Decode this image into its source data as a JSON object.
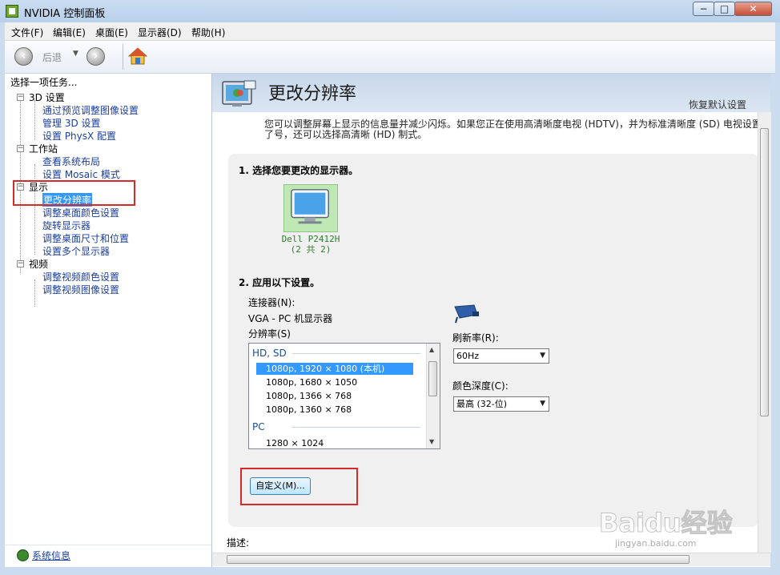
{
  "window": {
    "title": "NVIDIA 控制面板",
    "min_label": "−",
    "max_label": "□",
    "close_label": "✕"
  },
  "menu": {
    "items": [
      "文件(F)",
      "编辑(E)",
      "桌面(E)",
      "显示器(D)",
      "帮助(H)"
    ]
  },
  "toolbar": {
    "back_label": "后退",
    "back_icon": "‹",
    "forward_icon": "›",
    "dropdown_icon": "▼"
  },
  "left_pane": {
    "prompt": "选择一项任务...",
    "categories": [
      {
        "label": "3D 设置",
        "items": [
          "通过预览调整图像设置",
          "管理 3D 设置",
          "设置 PhysX 配置"
        ]
      },
      {
        "label": "工作站",
        "items": [
          "查看系统布局",
          "设置 Mosaic 模式"
        ]
      },
      {
        "label": "显示",
        "items": [
          "更改分辨率",
          "调整桌面颜色设置",
          "旋转显示器",
          "调整桌面尺寸和位置",
          "设置多个显示器"
        ]
      },
      {
        "label": "视频",
        "items": [
          "调整视频颜色设置",
          "调整视频图像设置"
        ]
      }
    ],
    "expander_symbol": "−",
    "system_info": "系统信息"
  },
  "page": {
    "title": "更改分辨率",
    "restore_defaults": "恢复默认设置",
    "description": "您可以调整屏幕上显示的信息量并减少闪烁。如果您正在使用高清晰度电视 (HDTV)，并为标准清晰度 (SD) 电视设置了号，还可以选择高清晰 (HD) 制式。",
    "step1": "1. 选择您要更改的显示器。",
    "monitor": {
      "name": "Dell P2412H",
      "index": "(2 共 2)"
    },
    "step2": "2. 应用以下设置。",
    "connector_label": "连接器(N):",
    "connector_value": "VGA - PC 机显示器",
    "resolution_label": "分辨率(S)",
    "resolution_groups": [
      {
        "header": "HD, SD",
        "rows": [
          "1080p, 1920 × 1080 (本机)",
          "1080p, 1680 × 1050",
          "1080p, 1366 × 768",
          "1080p, 1360 × 768"
        ]
      },
      {
        "header": "PC",
        "rows": [
          "1280 × 1024"
        ]
      }
    ],
    "selected_resolution": "1080p, 1920 × 1080 (本机)",
    "refresh_label": "刷新率(R):",
    "refresh_value": "60Hz",
    "color_depth_label": "颜色深度(C):",
    "color_depth_value": "最高 (32-位)",
    "custom_button": "自定义(M)...",
    "desc_label": "描述:"
  },
  "scrollbar": {
    "up": "▲",
    "down": "▼",
    "left": "◀",
    "right": "▶"
  },
  "watermark": {
    "text": "Baidu经验",
    "sub": "jingyan.baidu.com"
  },
  "colors": {
    "accent_select": "#3399ff",
    "highlight_box": "#d62a2a",
    "link": "#1a3e9c"
  }
}
